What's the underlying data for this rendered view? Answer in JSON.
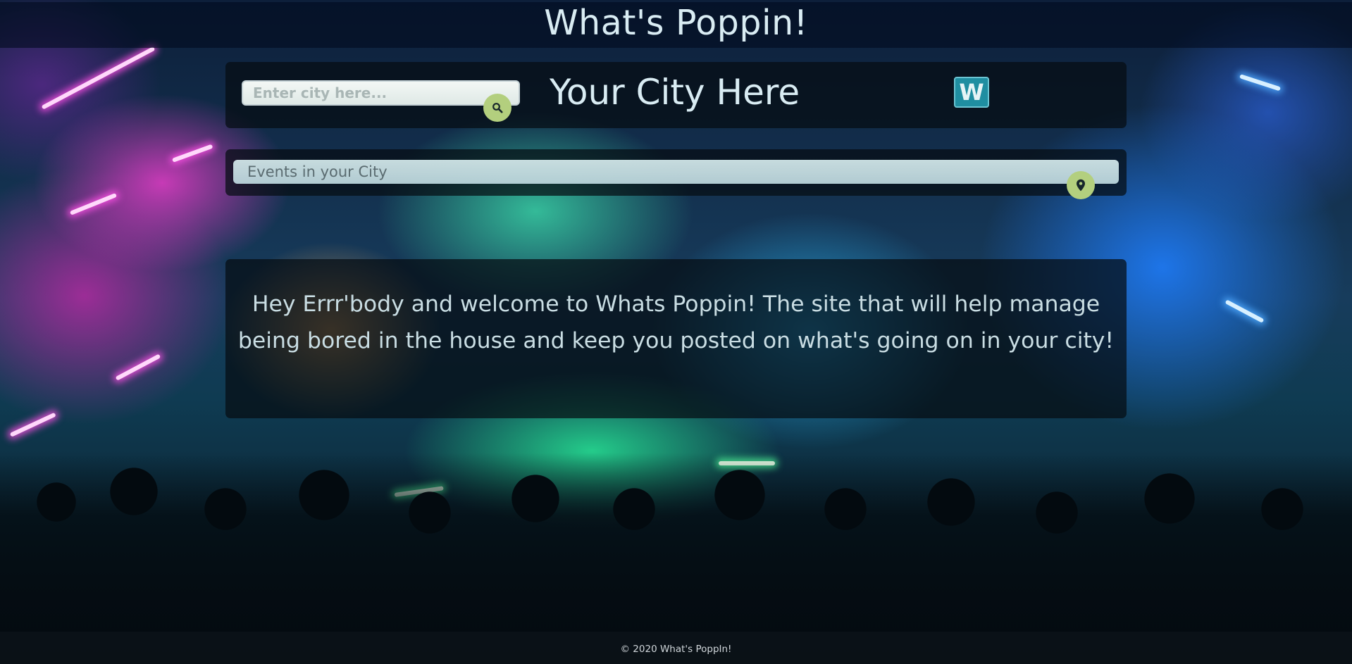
{
  "header": {
    "title": "What's Poppin!"
  },
  "search": {
    "placeholder": "Enter city here...",
    "value": "",
    "button_icon": "search-icon"
  },
  "city": {
    "heading": "Your City Here"
  },
  "weather_button": {
    "label": "W"
  },
  "events": {
    "label": "Events in your City",
    "button_icon": "location-pin-icon"
  },
  "intro": {
    "text": "Hey Errr'body and welcome to Whats Poppin! The site that will help manage being bored in the house and keep you posted on what's going on in your city!"
  },
  "footer": {
    "text": "© 2020 What's PoppIn!"
  },
  "colors": {
    "accent_button": "#b3cf7e",
    "weather_button": "#1f8ea1",
    "heading_text": "#d9ecf3"
  }
}
